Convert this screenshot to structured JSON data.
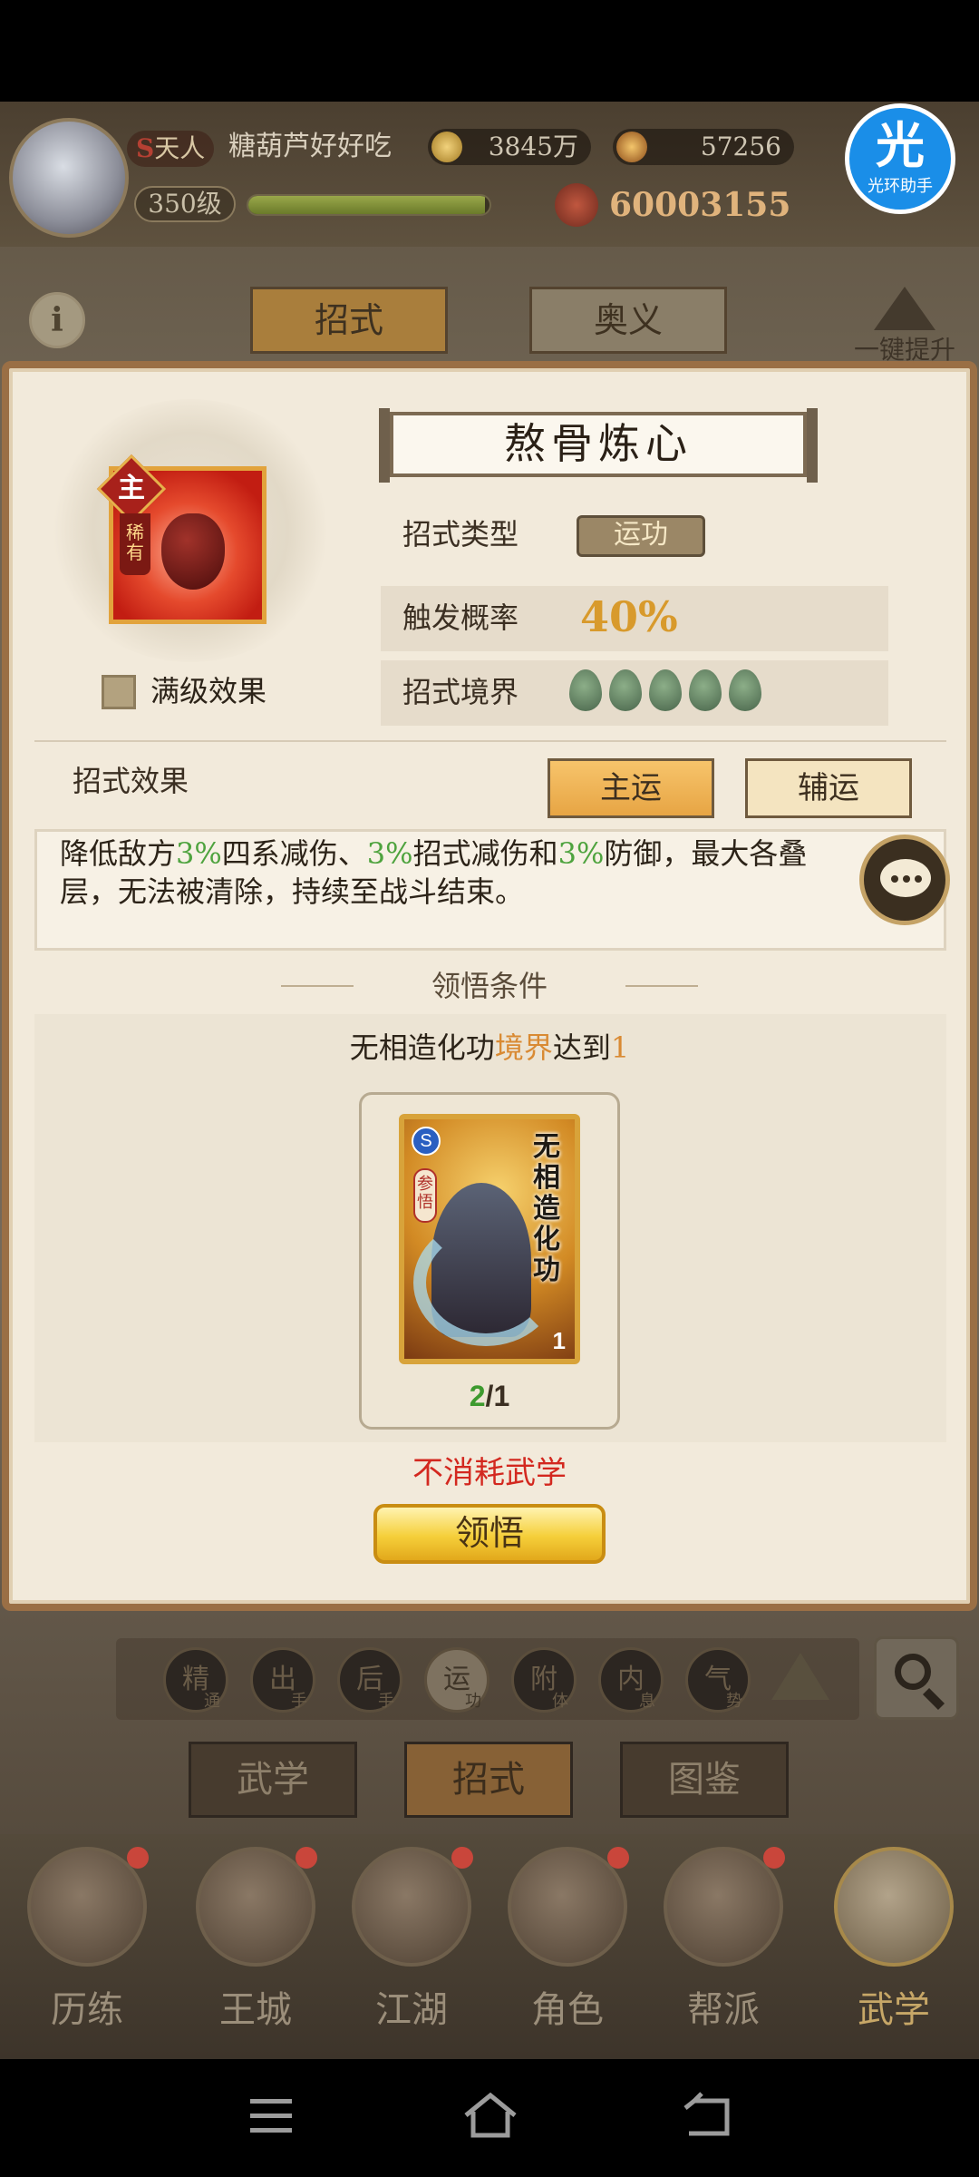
{
  "player": {
    "title_prefix": "S",
    "title": "天人",
    "name": "糖葫芦好好吃",
    "level": "350级",
    "xp_fraction": 0.98,
    "silver": "3845万",
    "gold": "57256",
    "power": "60003155"
  },
  "helper": {
    "glyph": "光",
    "label": "光环助手"
  },
  "top_tabs": {
    "info_icon": "i",
    "skills": "招式",
    "ultimate": "奥义",
    "upgrade_all": "一键提升"
  },
  "skill": {
    "main_badge": "主",
    "rare_badge": "稀有",
    "name": "熬骨炼心",
    "max_effect_label": "满级效果",
    "type_label": "招式类型",
    "type_value": "运功",
    "chance_label": "触发概率",
    "chance_value": "40%",
    "realm_label": "招式境界",
    "realm_count": 5
  },
  "effect": {
    "title": "招式效果",
    "main_button": "主运",
    "sub_button": "辅运",
    "text_parts": [
      "降低敌方",
      "3%",
      "四系减伤、",
      "3%",
      "招式减伤和",
      "3%",
      "防御，最大各叠",
      "层，无法被清除，持续至战斗结束。"
    ]
  },
  "condition": {
    "title": "领悟条件",
    "text_parts": [
      "无相造化功",
      "境界",
      "达到",
      "1"
    ],
    "card": {
      "grade": "S",
      "tag": "参悟",
      "title": "无相造化功",
      "level": "1",
      "count_have": "2",
      "count_sep": "/",
      "count_need": "1"
    },
    "no_consume": "不消耗武学",
    "comprehend_button": "领悟"
  },
  "filters": [
    "精",
    "出",
    "后",
    "运",
    "附",
    "内",
    "气"
  ],
  "filter_subs": [
    "通",
    "手",
    "手",
    "功",
    "体",
    "息",
    "势"
  ],
  "sub_tabs": [
    "武学",
    "招式",
    "图鉴"
  ],
  "bottom_nav": [
    "历练",
    "王城",
    "江湖",
    "角色",
    "帮派",
    "武学"
  ],
  "colors": {
    "accent_gold": "#f5cf3a",
    "highlight_green": "#4ea33e",
    "warning_red": "#d3281f",
    "panel_bg": "#f2eadb"
  }
}
